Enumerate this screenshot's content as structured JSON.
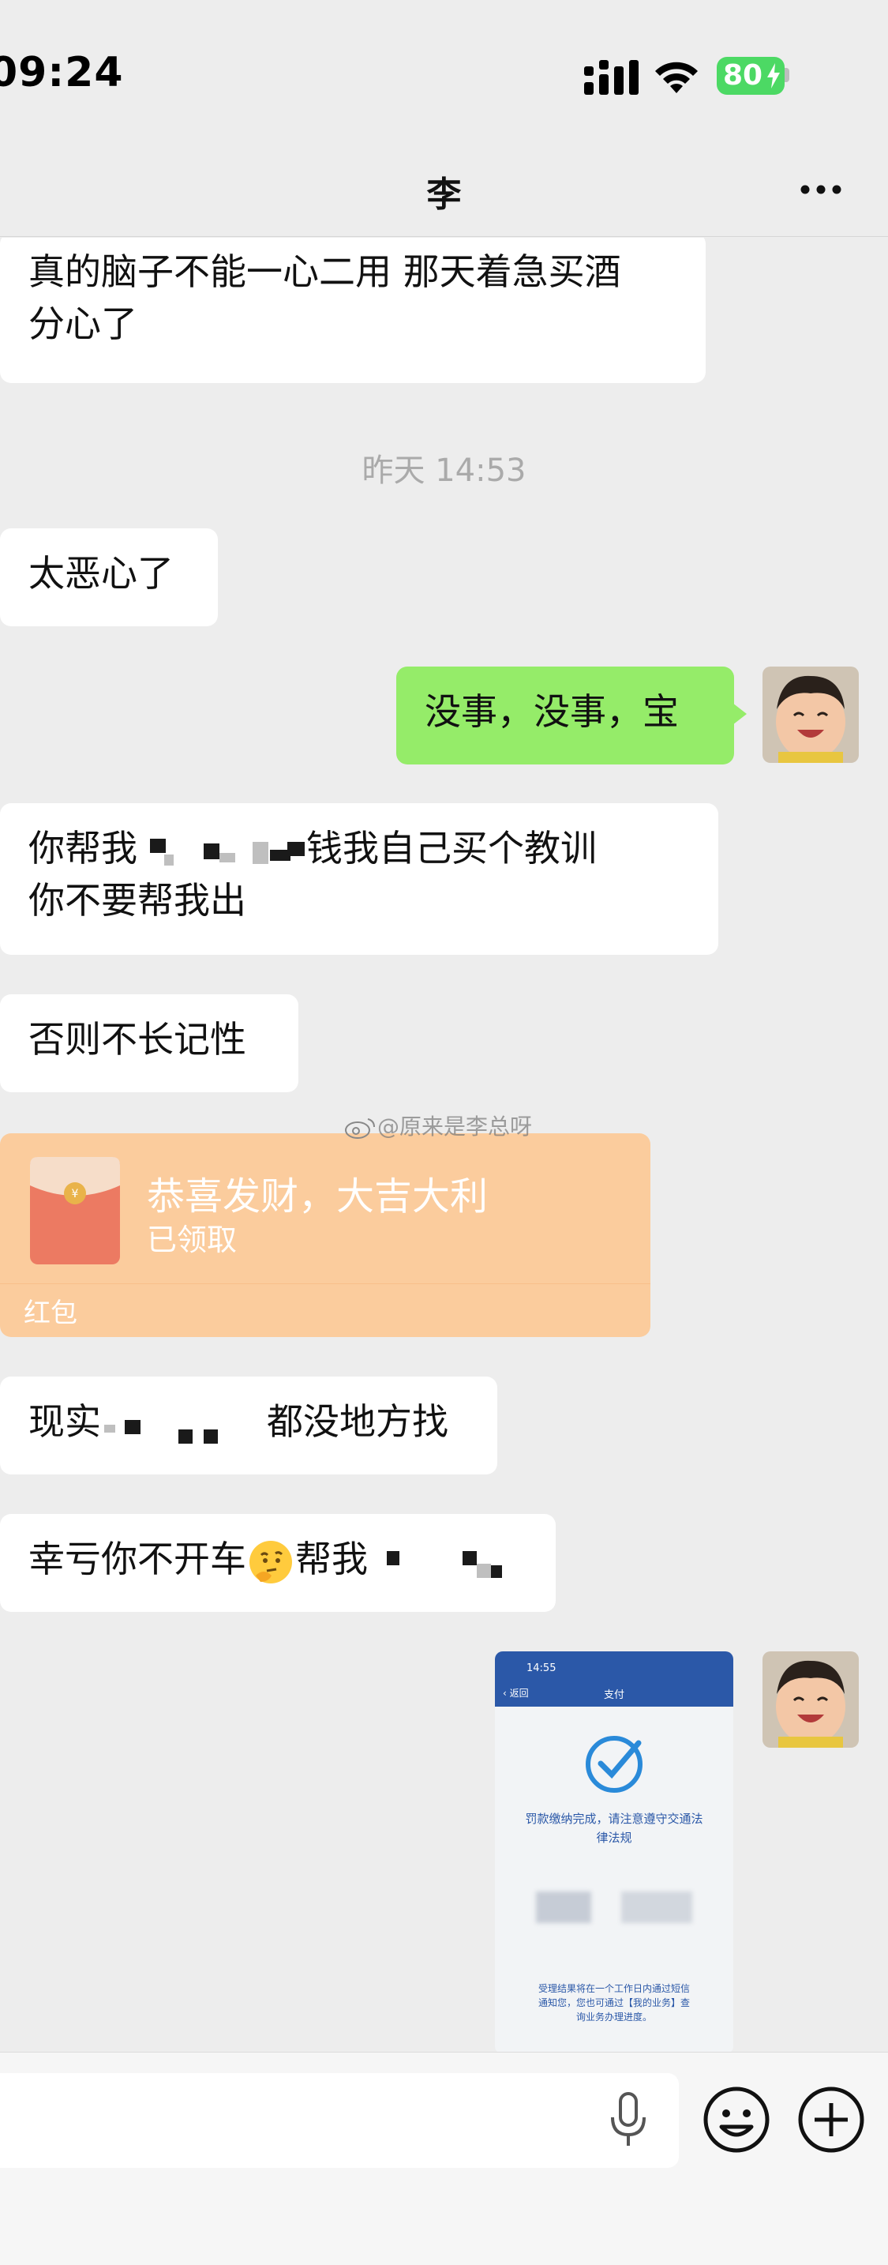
{
  "status_bar": {
    "time": "09:24",
    "battery": "80"
  },
  "nav": {
    "title": "李",
    "more_icon": "more-dots-icon"
  },
  "messages": [
    {
      "side": "left",
      "line1": "真的脑子不能一心二用 那天着急买酒",
      "line2": "分心了"
    },
    {
      "type": "timestamp",
      "text": "昨天 14:53"
    },
    {
      "side": "left",
      "text": "太恶心了"
    },
    {
      "side": "right",
      "text": "没事，没事，宝"
    },
    {
      "side": "left",
      "part1": "你帮我",
      "part2": "钱我自己买个教训",
      "line2": "你不要帮我出"
    },
    {
      "side": "left",
      "text": "否则不长记性"
    },
    {
      "type": "red_packet",
      "title": "恭喜发财，大吉大利",
      "status": "已领取",
      "label": "红包"
    },
    {
      "side": "left",
      "part1": "现实",
      "part2": "都没地方找"
    },
    {
      "side": "left",
      "part1": "幸亏你不开车",
      "emoji": "thinking-face-icon",
      "part2": "帮我"
    },
    {
      "type": "image_screenshot",
      "time": "14:55",
      "back": "返回",
      "title": "支付",
      "result_line1": "罚款缴纳完成，请注意遵守交通法",
      "result_line2": "律法规",
      "note_line1": "受理结果将在一个工作日内通过短信",
      "note_line2": "通知您，您也可通过【我的业务】查",
      "note_line3": "询业务办理进度。"
    }
  ],
  "watermark": "@原来是李总呀",
  "input_bar": {
    "icons": [
      "voice-icon",
      "emoji-icon",
      "plus-icon"
    ]
  },
  "colors": {
    "background": "#ededed",
    "my_bubble": "#95ec69",
    "their_bubble": "#ffffff",
    "red_packet": "#fbcc9d",
    "battery": "#4cd964"
  }
}
